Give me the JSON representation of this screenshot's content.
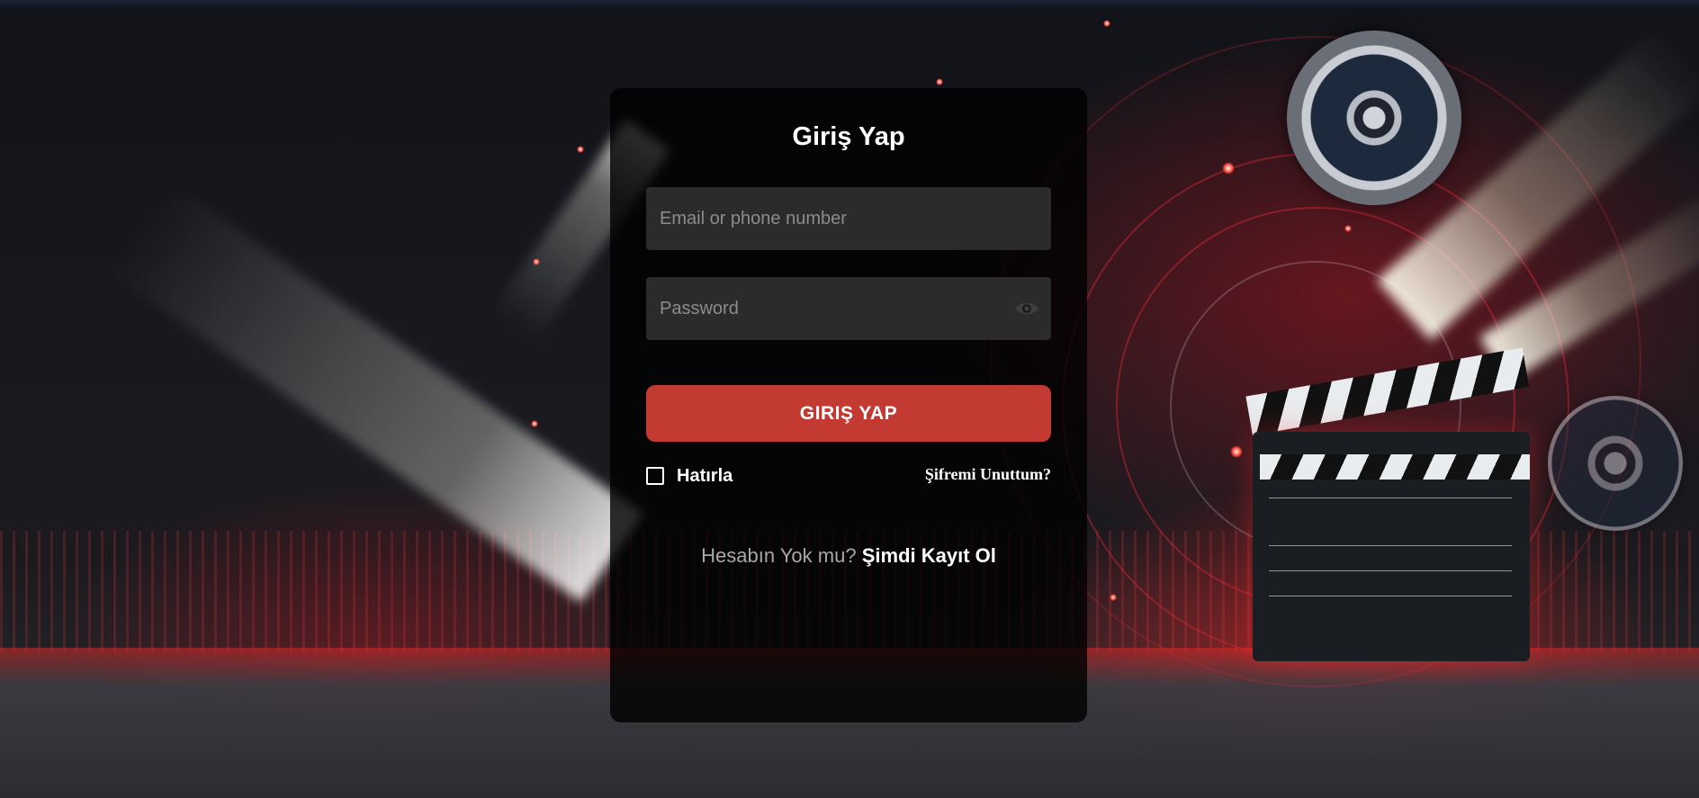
{
  "login": {
    "title": "Giriş Yap",
    "email_placeholder": "Email or phone number",
    "password_placeholder": "Password",
    "submit_label": "GIRIŞ YAP",
    "remember_label": "Hatırla",
    "forgot_label": "Şifremi Unuttum?",
    "signup_prompt": "Hesabın Yok mu?",
    "signup_link": "Şimdi Kayıt Ol"
  },
  "icons": {
    "password_toggle": "eye-icon"
  },
  "colors": {
    "accent": "#c33a33",
    "card_bg": "#000000",
    "input_bg": "#2b2b2b"
  }
}
